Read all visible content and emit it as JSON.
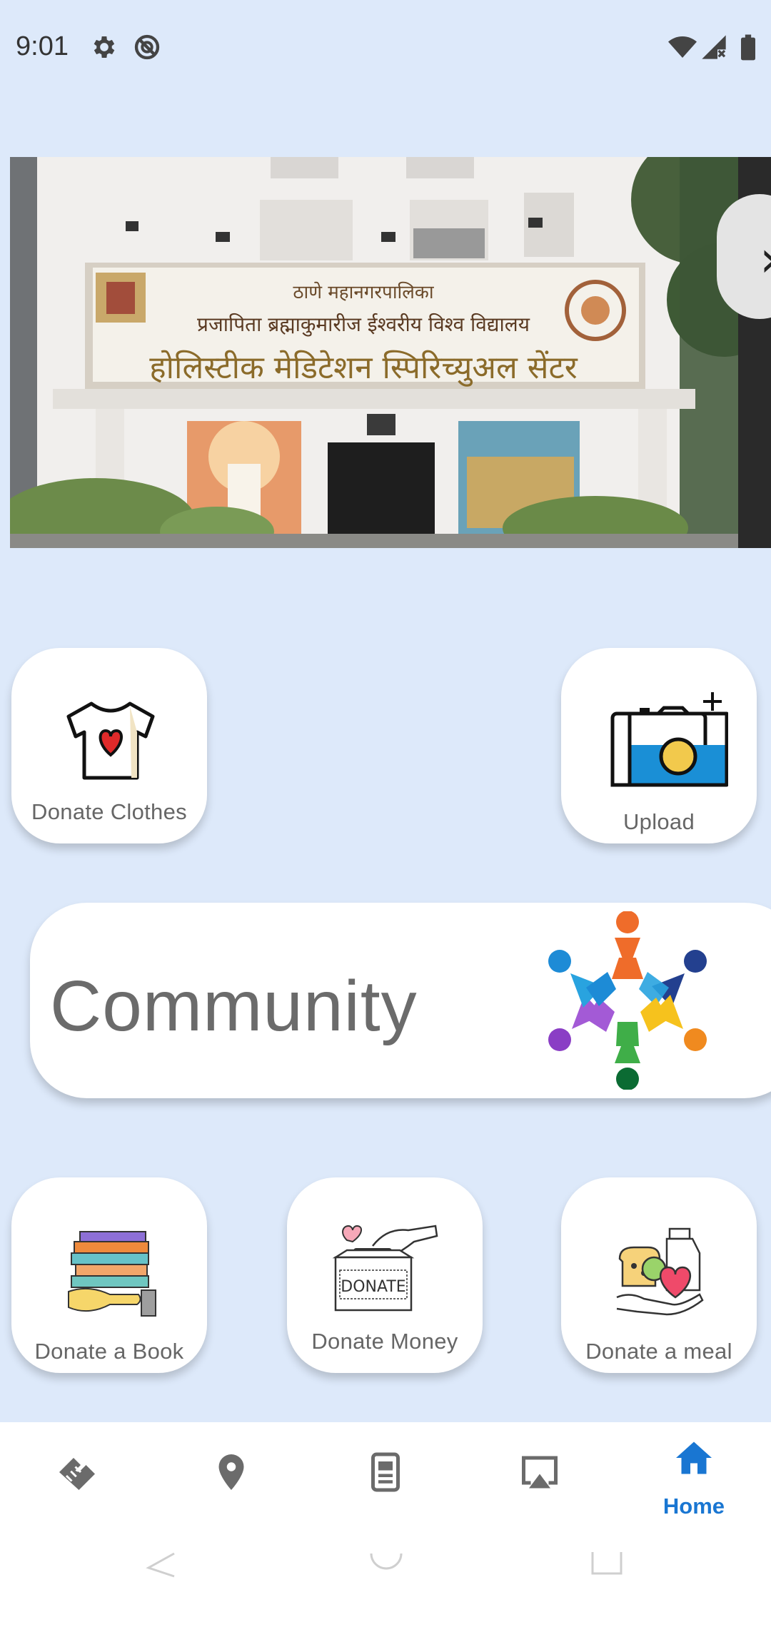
{
  "status_bar": {
    "time": "9:01",
    "icons": [
      "gear-icon",
      "do-not-disturb-icon",
      "wifi-icon",
      "signal-icon",
      "battery-icon"
    ]
  },
  "banner": {
    "sign_line_1": "ठाणे महानगरपालिका",
    "sign_line_2": "प्रजापिता ब्रह्माकुमारीज ईश्वरीय विश्व विद्यालय",
    "sign_line_3": "होलिस्टीक मेडिटेशन स्पिरिच्युअल सेंटर"
  },
  "cards": {
    "donate_clothes": "Donate Clothes",
    "upload": "Upload",
    "community": "Community",
    "donate_book": "Donate a Book",
    "donate_money": "Donate Money",
    "donate_meal": "Donate a meal",
    "donate_box_text": "DONATE"
  },
  "bottom_nav": {
    "items": [
      {
        "icon": "handshake-icon",
        "label": ""
      },
      {
        "icon": "location-pin-icon",
        "label": ""
      },
      {
        "icon": "document-icon",
        "label": ""
      },
      {
        "icon": "screencast-icon",
        "label": ""
      },
      {
        "icon": "home-icon",
        "label": "Home"
      }
    ],
    "active_color": "#1976d2",
    "inactive_color": "#6b6b6b"
  },
  "colors": {
    "background": "#dde9fa",
    "card": "#ffffff",
    "accent": "#1976d2"
  }
}
